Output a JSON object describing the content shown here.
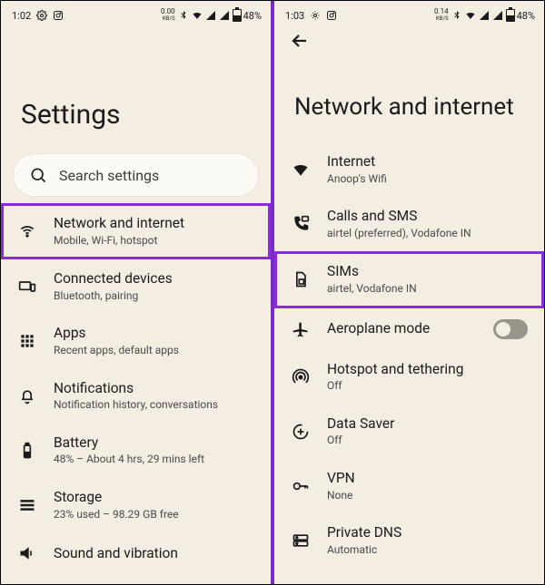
{
  "left": {
    "statusbar": {
      "time": "1:02",
      "kbps": "0.00",
      "kbps_unit": "KB/S",
      "battery": "48%"
    },
    "title": "Settings",
    "search_placeholder": "Search settings",
    "items": [
      {
        "icon": "wifi",
        "label": "Network and internet",
        "sub": "Mobile, Wi-Fi, hotspot",
        "highlight": true
      },
      {
        "icon": "devices",
        "label": "Connected devices",
        "sub": "Bluetooth, pairing"
      },
      {
        "icon": "apps",
        "label": "Apps",
        "sub": "Recent apps, default apps"
      },
      {
        "icon": "bell",
        "label": "Notifications",
        "sub": "Notification history, conversations"
      },
      {
        "icon": "battery",
        "label": "Battery",
        "sub": "48% – About 4 hrs, 29 mins left"
      },
      {
        "icon": "storage",
        "label": "Storage",
        "sub": "23% used – 98.29 GB free"
      },
      {
        "icon": "sound",
        "label": "Sound and vibration",
        "sub": ""
      }
    ]
  },
  "right": {
    "statusbar": {
      "time": "1:03",
      "kbps": "0.14",
      "kbps_unit": "KB/S",
      "battery": "48%"
    },
    "title": "Network and internet",
    "items": [
      {
        "icon": "wifi-full",
        "label": "Internet",
        "sub": "Anoop's Wifi"
      },
      {
        "icon": "calls",
        "label": "Calls and SMS",
        "sub": "airtel (preferred), Vodafone IN"
      },
      {
        "icon": "sim",
        "label": "SIMs",
        "sub": "airtel, Vodafone IN",
        "highlight": true
      },
      {
        "icon": "plane",
        "label": "Aeroplane mode",
        "sub": "",
        "toggle": true
      },
      {
        "icon": "hotspot",
        "label": "Hotspot and tethering",
        "sub": "Off"
      },
      {
        "icon": "datasaver",
        "label": "Data Saver",
        "sub": "Off"
      },
      {
        "icon": "vpn",
        "label": "VPN",
        "sub": "None"
      },
      {
        "icon": "dns",
        "label": "Private DNS",
        "sub": "Automatic"
      }
    ]
  }
}
